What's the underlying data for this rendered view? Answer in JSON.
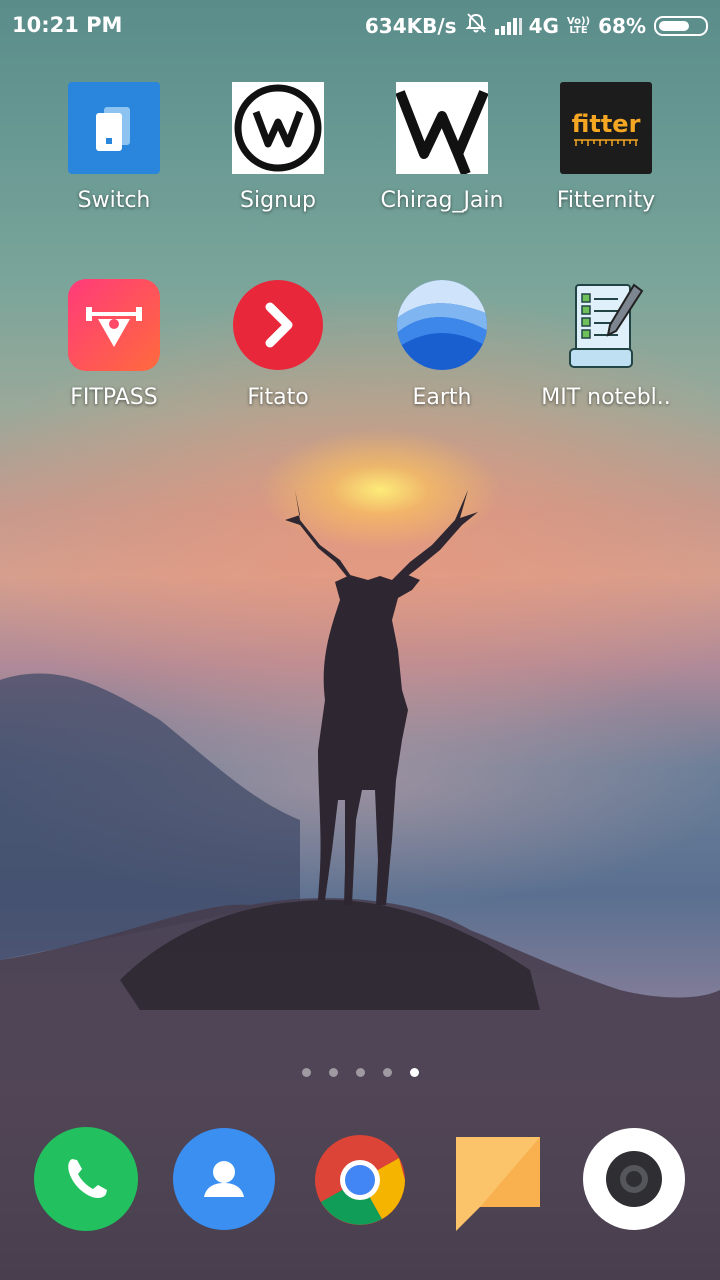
{
  "status_bar": {
    "time": "10:21 PM",
    "network_speed": "634KB/s",
    "network_type": "4G",
    "volte_top": "Vo))",
    "volte_bottom": "LTE",
    "battery": "68%",
    "battery_level": 0.68
  },
  "apps": [
    {
      "label": "Switch",
      "icon": "switch-icon"
    },
    {
      "label": "Signup",
      "icon": "w-logo-round-icon"
    },
    {
      "label": "Chirag_Jain",
      "icon": "w-logo-square-icon"
    },
    {
      "label": "Fitternity",
      "icon": "fitter-icon",
      "icon_text": "fitter"
    },
    {
      "label": "FITPASS",
      "icon": "fitpass-icon"
    },
    {
      "label": "Fitato",
      "icon": "fitato-icon"
    },
    {
      "label": "Earth",
      "icon": "earth-icon"
    },
    {
      "label": "MIT notebl..",
      "icon": "notebook-icon"
    }
  ],
  "page_indicator": {
    "count": 5,
    "active_index": 4
  },
  "dock": [
    {
      "name": "phone",
      "icon": "phone-icon",
      "color": "#22c05e"
    },
    {
      "name": "contacts",
      "icon": "contacts-icon",
      "color": "#3a8ff0"
    },
    {
      "name": "chrome",
      "icon": "chrome-icon"
    },
    {
      "name": "messaging",
      "icon": "message-icon",
      "color": "#fbc46a"
    },
    {
      "name": "camera",
      "icon": "camera-icon"
    }
  ]
}
